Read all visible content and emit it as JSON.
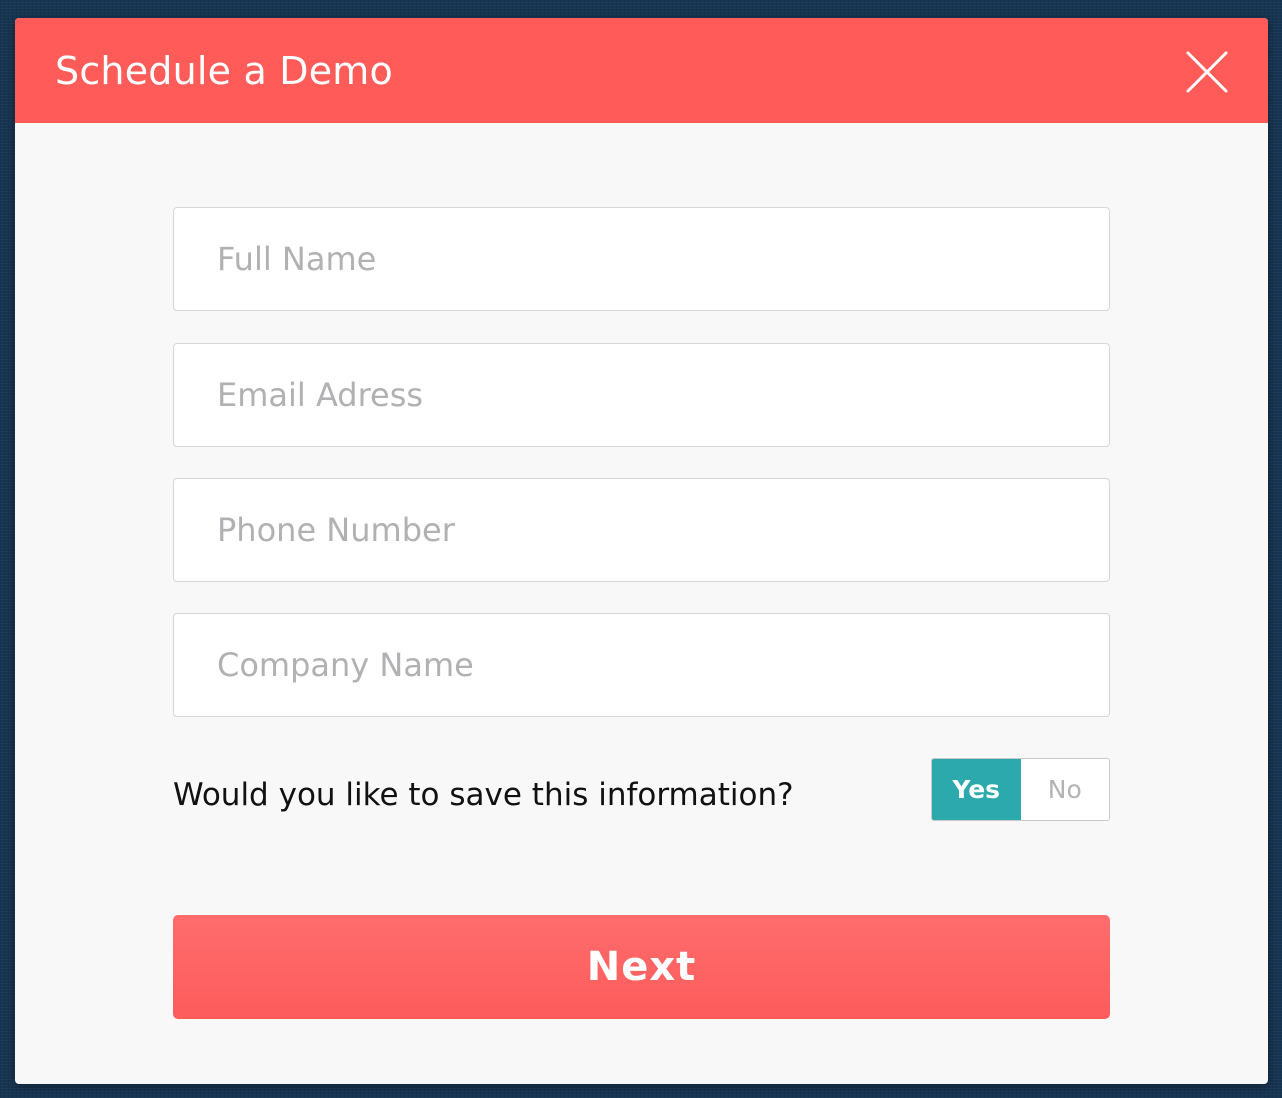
{
  "modal": {
    "title": "Schedule a Demo",
    "close_icon": "close-icon"
  },
  "form": {
    "full_name_placeholder": "Full Name",
    "email_placeholder": "Email Adress",
    "phone_placeholder": "Phone Number",
    "company_placeholder": "Company Name",
    "save_question": "Would you like to save this information?",
    "save_toggle": {
      "yes_label": "Yes",
      "no_label": "No",
      "selected": "Yes"
    },
    "next_label": "Next"
  },
  "colors": {
    "header": "#fe5b59",
    "accent_teal": "#2ba9ac",
    "next_button": "#fd5c5b",
    "background": "#173552"
  }
}
